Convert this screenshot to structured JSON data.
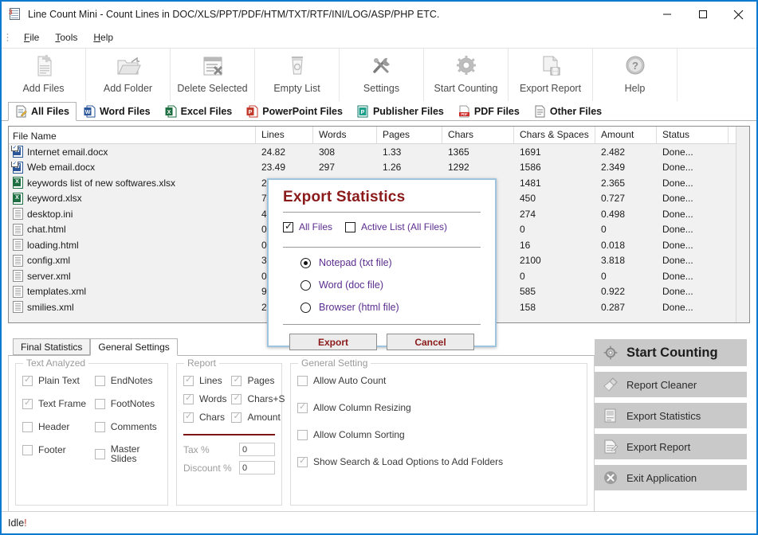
{
  "window": {
    "title": "Line Count Mini - Count Lines in DOC/XLS/PPT/PDF/HTM/TXT/RTF/INI/LOG/ASP/PHP ETC.",
    "icon": "document-number-icon",
    "minimize_label": "–",
    "maximize_label": "□",
    "close_label": "✕"
  },
  "menubar": {
    "items": [
      {
        "label": "File",
        "accel": "F"
      },
      {
        "label": "Tools",
        "accel": "T"
      },
      {
        "label": "Help",
        "accel": "H"
      }
    ]
  },
  "toolbar": {
    "items": [
      {
        "label": "Add Files",
        "icon": "add-files-icon"
      },
      {
        "label": "Add Folder",
        "icon": "add-folder-icon"
      },
      {
        "label": "Delete Selected",
        "icon": "delete-selected-icon"
      },
      {
        "label": "Empty List",
        "icon": "empty-list-icon"
      },
      {
        "label": "Settings",
        "icon": "settings-wrench-icon"
      },
      {
        "label": "Start Counting",
        "icon": "gear-icon"
      },
      {
        "label": "Export Report",
        "icon": "export-report-icon"
      },
      {
        "label": "Help",
        "icon": "help-question-icon"
      }
    ]
  },
  "filetabs": {
    "active": "All Files",
    "items": [
      {
        "label": "All Files",
        "icon": "all-files-icon",
        "color": "#f3f3f3"
      },
      {
        "label": "Word Files",
        "icon": "word-icon",
        "color": "#2a5699"
      },
      {
        "label": "Excel Files",
        "icon": "excel-icon",
        "color": "#1d6f42"
      },
      {
        "label": "PowerPoint Files",
        "icon": "powerpoint-icon",
        "color": "#c0392b"
      },
      {
        "label": "Publisher Files",
        "icon": "publisher-icon",
        "color": "#10796b"
      },
      {
        "label": "PDF Files",
        "icon": "pdf-icon",
        "color": "#cf2a2a"
      },
      {
        "label": "Other Files",
        "icon": "other-files-icon",
        "color": "#f3f3f3"
      }
    ]
  },
  "filelist": {
    "columns": [
      "File Name",
      "Lines",
      "Words",
      "Pages",
      "Chars",
      "Chars & Spaces",
      "Amount",
      "Status"
    ],
    "rows": [
      {
        "name": "Internet email.docx",
        "type": "word",
        "checked": true,
        "lines": "24.82",
        "words": "308",
        "pages": "1.33",
        "chars": "1365",
        "chars_spaces": "1691",
        "amount": "2.482",
        "status": "Done..."
      },
      {
        "name": "Web email.docx",
        "type": "word",
        "checked": true,
        "lines": "23.49",
        "words": "297",
        "pages": "1.26",
        "chars": "1292",
        "chars_spaces": "1586",
        "amount": "2.349",
        "status": "Done..."
      },
      {
        "name": "keywords list of new softwares.xlsx",
        "type": "excel",
        "checked": false,
        "lines": "2",
        "words": "",
        "pages": "",
        "chars": "",
        "chars_spaces": "1481",
        "amount": "2.365",
        "status": "Done..."
      },
      {
        "name": "keyword.xlsx",
        "type": "excel",
        "checked": false,
        "lines": "7",
        "words": "",
        "pages": "",
        "chars": "",
        "chars_spaces": "450",
        "amount": "0.727",
        "status": "Done..."
      },
      {
        "name": "desktop.ini",
        "type": "other",
        "checked": false,
        "lines": "4",
        "words": "",
        "pages": "",
        "chars": "",
        "chars_spaces": "274",
        "amount": "0.498",
        "status": "Done..."
      },
      {
        "name": "chat.html",
        "type": "other",
        "checked": false,
        "lines": "0",
        "words": "",
        "pages": "",
        "chars": "",
        "chars_spaces": "0",
        "amount": "0",
        "status": "Done..."
      },
      {
        "name": "loading.html",
        "type": "other",
        "checked": false,
        "lines": "0",
        "words": "",
        "pages": "",
        "chars": "",
        "chars_spaces": "16",
        "amount": "0.018",
        "status": "Done..."
      },
      {
        "name": "config.xml",
        "type": "other",
        "checked": false,
        "lines": "3",
        "words": "",
        "pages": "",
        "chars": "",
        "chars_spaces": "2100",
        "amount": "3.818",
        "status": "Done..."
      },
      {
        "name": "server.xml",
        "type": "other",
        "checked": false,
        "lines": "0",
        "words": "",
        "pages": "",
        "chars": "",
        "chars_spaces": "0",
        "amount": "0",
        "status": "Done..."
      },
      {
        "name": "templates.xml",
        "type": "other",
        "checked": false,
        "lines": "9",
        "words": "",
        "pages": "",
        "chars": "",
        "chars_spaces": "585",
        "amount": "0.922",
        "status": "Done..."
      },
      {
        "name": "smilies.xml",
        "type": "other",
        "checked": false,
        "lines": "2",
        "words": "",
        "pages": "",
        "chars": "",
        "chars_spaces": "158",
        "amount": "0.287",
        "status": "Done..."
      }
    ]
  },
  "dialog": {
    "title": "Export Statistics",
    "checkboxes": [
      {
        "label": "All Files",
        "checked": true
      },
      {
        "label": "Active List (All Files)",
        "checked": false
      }
    ],
    "radios": [
      {
        "label": "Notepad (txt file)",
        "selected": true
      },
      {
        "label": "Word (doc file)",
        "selected": false
      },
      {
        "label": "Browser (html file)",
        "selected": false
      }
    ],
    "export_label": "Export",
    "cancel_label": "Cancel",
    "title_color": "#8B1A1A",
    "label_color": "#5b2d8e",
    "border_color": "#9ec5e0"
  },
  "bottom_tabs": {
    "active": "General Settings",
    "items": [
      "Final Statistics",
      "General Settings"
    ]
  },
  "text_analyzed": {
    "title": "Text Analyzed",
    "left": [
      {
        "label": "Plain Text",
        "checked": true
      },
      {
        "label": "Text Frame",
        "checked": true
      },
      {
        "label": "Header",
        "checked": false
      },
      {
        "label": "Footer",
        "checked": false
      }
    ],
    "right": [
      {
        "label": "EndNotes",
        "checked": false
      },
      {
        "label": "FootNotes",
        "checked": false
      },
      {
        "label": "Comments",
        "checked": false
      },
      {
        "label": "Master Slides",
        "checked": false
      }
    ]
  },
  "report": {
    "title": "Report",
    "col1": [
      {
        "label": "Lines",
        "checked": true
      },
      {
        "label": "Words",
        "checked": true
      },
      {
        "label": "Chars",
        "checked": true
      }
    ],
    "col2": [
      {
        "label": "Pages",
        "checked": true
      },
      {
        "label": "Chars+S",
        "checked": true
      },
      {
        "label": "Amount",
        "checked": true
      }
    ],
    "tax_label": "Tax %",
    "tax_value": "0",
    "discount_label": "Discount %",
    "discount_value": "0"
  },
  "general_setting": {
    "title": "General Setting",
    "items": [
      {
        "label": "Allow Auto Count",
        "checked": false
      },
      {
        "label": "Allow Column Resizing",
        "checked": true
      },
      {
        "label": "Allow Column Sorting",
        "checked": false
      },
      {
        "label": "Show Search & Load Options to Add Folders",
        "checked": true
      }
    ]
  },
  "actions": [
    {
      "label": "Start Counting",
      "icon": "gear-icon",
      "primary": true
    },
    {
      "label": "Report Cleaner",
      "icon": "brush-icon",
      "primary": false
    },
    {
      "label": "Export Statistics",
      "icon": "export-statistics-icon",
      "primary": false
    },
    {
      "label": "Export Report",
      "icon": "export-report-icon",
      "primary": false
    },
    {
      "label": "Exit Application",
      "icon": "exit-icon",
      "primary": false
    }
  ],
  "statusbar": {
    "text": "Idle",
    "exclaim": "!"
  }
}
